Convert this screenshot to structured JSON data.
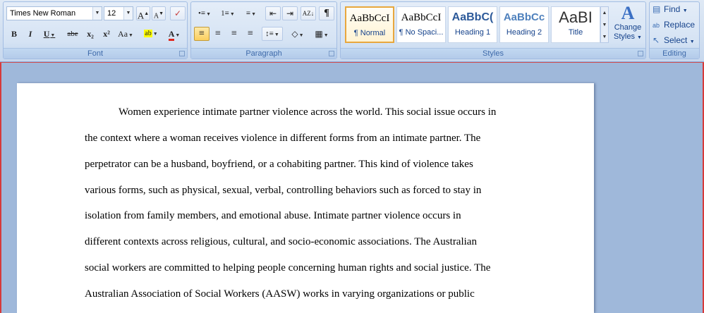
{
  "font_group": {
    "label": "Font",
    "font_name": "Times New Roman",
    "font_size": "12",
    "grow_font": "A",
    "shrink_font": "A",
    "clear_format": "✓",
    "bold": "B",
    "italic": "I",
    "underline": "U",
    "strike": "abe",
    "subscript": "x₂",
    "superscript": "x²",
    "change_case": "Aa",
    "highlight": "ab",
    "font_color": "A"
  },
  "paragraph_group": {
    "label": "Paragraph",
    "bullets": "•≡",
    "numbering": "1≡",
    "multilevel": "≡",
    "decrease_indent": "⇤",
    "increase_indent": "⇥",
    "sort": "AZ↓",
    "show_marks": "¶",
    "align_left": "≡",
    "center": "≡",
    "align_right": "≡",
    "justify": "≡",
    "line_spacing": "↕≡",
    "shading": "◇",
    "borders": "▦"
  },
  "styles_group": {
    "label": "Styles",
    "tiles": [
      {
        "sample": "AaBbCcI",
        "name": "¶ Normal"
      },
      {
        "sample": "AaBbCcI",
        "name": "¶ No Spaci..."
      },
      {
        "sample": "AaBbC(",
        "name": "Heading 1"
      },
      {
        "sample": "AaBbCc",
        "name": "Heading 2"
      },
      {
        "sample": "AaBI",
        "name": "Title"
      }
    ],
    "change_styles_line1": "Change",
    "change_styles_line2": "Styles"
  },
  "editing_group": {
    "label": "Editing",
    "find": "Find",
    "replace": "Replace",
    "select": "Select"
  },
  "document": {
    "lines": [
      "Women experience intimate partner violence across the world. This social issue occurs in",
      "the context where a woman receives violence in different forms from an intimate partner. The",
      "perpetrator can be a husband, boyfriend, or a cohabiting partner. This kind of violence takes",
      "various forms, such as physical, sexual, verbal, controlling behaviors such as forced to stay in",
      "isolation from family members, and emotional abuse. Intimate partner violence occurs in",
      "different contexts across religious, cultural, and socio-economic associations. The Australian",
      "social workers are committed to helping people concerning human rights and social justice. The",
      "Australian Association of Social Workers (AASW) works in varying organizations or public"
    ]
  }
}
